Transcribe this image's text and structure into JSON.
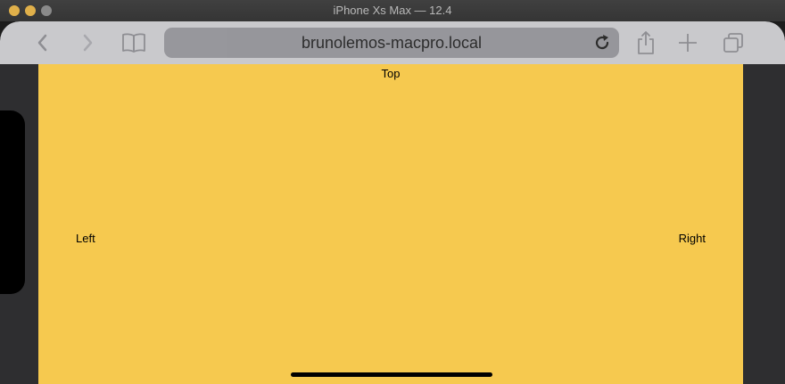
{
  "window": {
    "title": "iPhone Xs Max — 12.4"
  },
  "browser": {
    "url": "brunolemos-macpro.local",
    "back_icon": "chevron-left-icon",
    "forward_icon": "chevron-right-icon",
    "bookmarks_icon": "book-icon",
    "reload_icon": "reload-icon",
    "share_icon": "share-icon",
    "new_tab_icon": "plus-icon",
    "tabs_icon": "tabs-icon"
  },
  "page": {
    "background_color": "#f6c94f",
    "top_label": "Top",
    "left_label": "Left",
    "right_label": "Right"
  }
}
